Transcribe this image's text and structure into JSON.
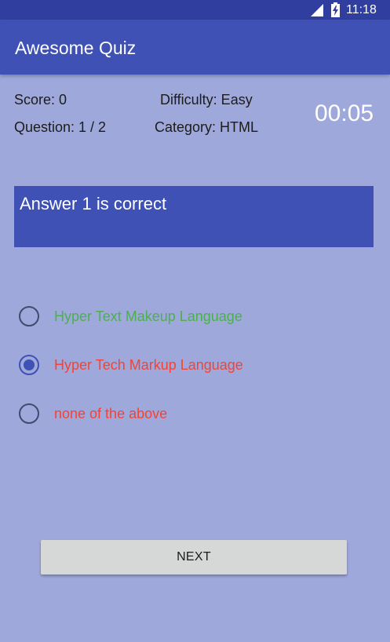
{
  "status_bar": {
    "time": "11:18",
    "icons": [
      "signal-icon",
      "battery-charging-icon"
    ]
  },
  "app_bar": {
    "title": "Awesome Quiz",
    "color": "#3f51b5"
  },
  "quiz_info": {
    "score": "Score: 0",
    "question_count": "Question: 1 / 2",
    "difficulty": "Difficulty: Easy",
    "category": "Category: HTML",
    "timer": "00:05"
  },
  "question": {
    "text": "Answer 1 is correct"
  },
  "options": [
    {
      "label": "Hyper Text Makeup Language",
      "color": "#4caf50",
      "selected": false
    },
    {
      "label": "Hyper Tech Markup Language",
      "color": "#f44336",
      "selected": true
    },
    {
      "label": "none of the above",
      "color": "#f44336",
      "selected": false
    }
  ],
  "next_button": {
    "label": "NEXT"
  },
  "colors": {
    "background": "#9fa8da",
    "primary": "#3f51b5",
    "primary_dark": "#303f9f",
    "correct": "#4caf50",
    "wrong": "#f44336"
  }
}
